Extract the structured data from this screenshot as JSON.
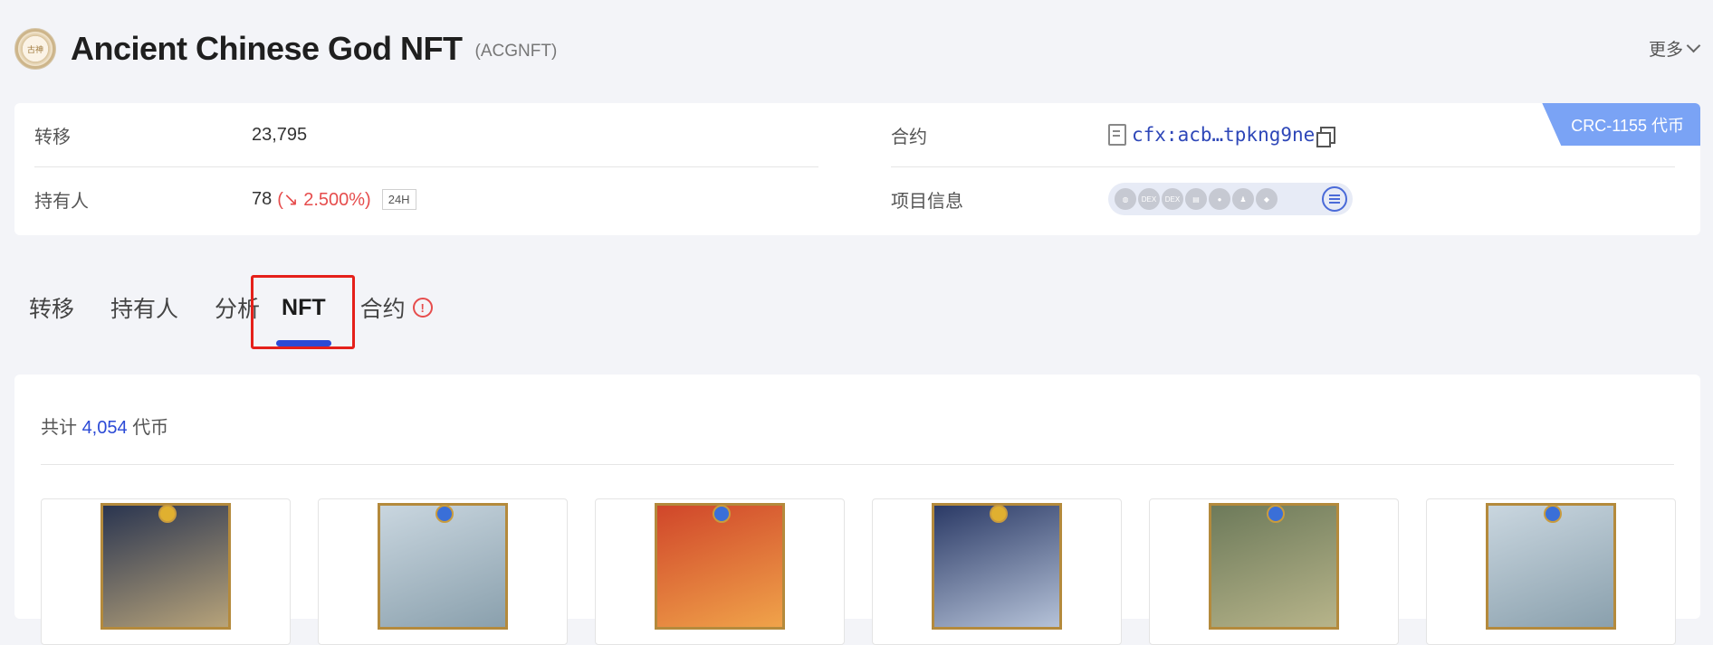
{
  "header": {
    "logo_text": "古神",
    "title": "Ancient Chinese God NFT",
    "symbol": "(ACGNFT)",
    "more": "更多"
  },
  "info": {
    "transfers_label": "转移",
    "transfers_value": "23,795",
    "holders_label": "持有人",
    "holders_value": "78",
    "holders_change": "(↘ 2.500%)",
    "holders_period": "24H",
    "contract_label": "合约",
    "contract_address": "cfx:acb…tpkng9ne",
    "project_label": "项目信息",
    "token_type": "CRC-1155 代币",
    "project_icons": [
      "globe-icon",
      "dex-icon",
      "dex-icon",
      "doc-icon",
      "people-icon",
      "person-icon",
      "shield-icon"
    ]
  },
  "tabs": [
    {
      "label": "转移"
    },
    {
      "label": "持有人"
    },
    {
      "label": "分析"
    },
    {
      "label": "NFT"
    },
    {
      "label": "合约"
    }
  ],
  "nft": {
    "total_prefix": "共计",
    "total_count": "4,054",
    "total_suffix": "代币",
    "cards": [
      {
        "colors": [
          "#2a3550",
          "#b7a37a"
        ],
        "gem": "#e0b030"
      },
      {
        "colors": [
          "#c9d6df",
          "#8aa0ad"
        ],
        "gem": "#3a6fd8"
      },
      {
        "colors": [
          "#d0462a",
          "#f0a34a"
        ],
        "gem": "#3a6fd8"
      },
      {
        "colors": [
          "#2b3a66",
          "#b5c2d8"
        ],
        "gem": "#e0b030"
      },
      {
        "colors": [
          "#6d7a5a",
          "#b7b48a"
        ],
        "gem": "#3a6fd8"
      },
      {
        "colors": [
          "#c9d6df",
          "#8aa0ad"
        ],
        "gem": "#3a6fd8"
      }
    ]
  },
  "colors": {
    "accent": "#2b4ad6",
    "danger": "#e64c4c",
    "badge": "#7aa3f5"
  }
}
